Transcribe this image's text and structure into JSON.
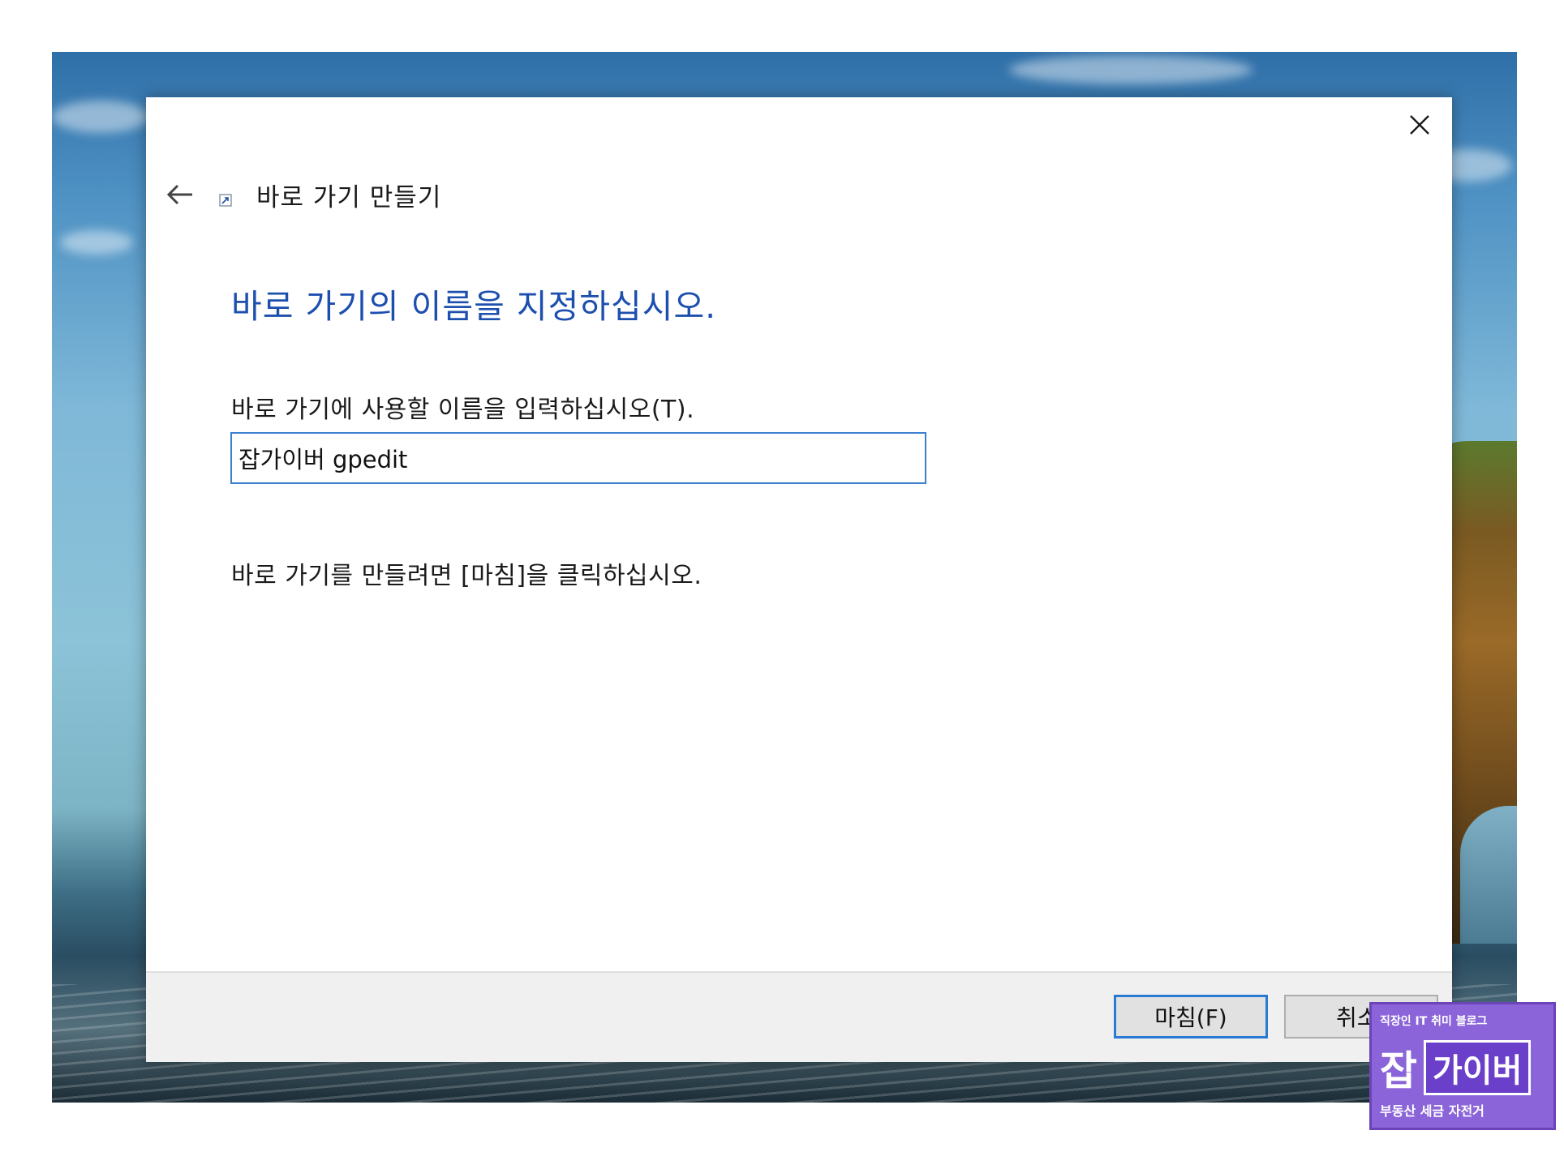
{
  "window": {
    "header_title": "바로 가기 만들기",
    "close_icon": "close-icon",
    "back_icon": "back-arrow-icon",
    "shortcut_icon": "shortcut-overlay-icon"
  },
  "content": {
    "instruction": "바로 가기의 이름을 지정하십시오.",
    "field_label": "바로 가기에 사용할 이름을 입력하십시오(T).",
    "name_value": "잡가이버 gpedit",
    "finish_note": "바로 가기를 만들려면 [마침]을 클릭하십시오."
  },
  "footer": {
    "finish_label": "마침(F)",
    "cancel_label": "취소"
  },
  "watermark": {
    "top": "직장인 IT 취미 블로그",
    "char": "잡",
    "name": "가이버",
    "bottom": "부동산 세금 자전거"
  },
  "colors": {
    "accent": "#1d4faf",
    "focus_border": "#3c7fd1",
    "watermark_bg": "#8a64d8"
  }
}
